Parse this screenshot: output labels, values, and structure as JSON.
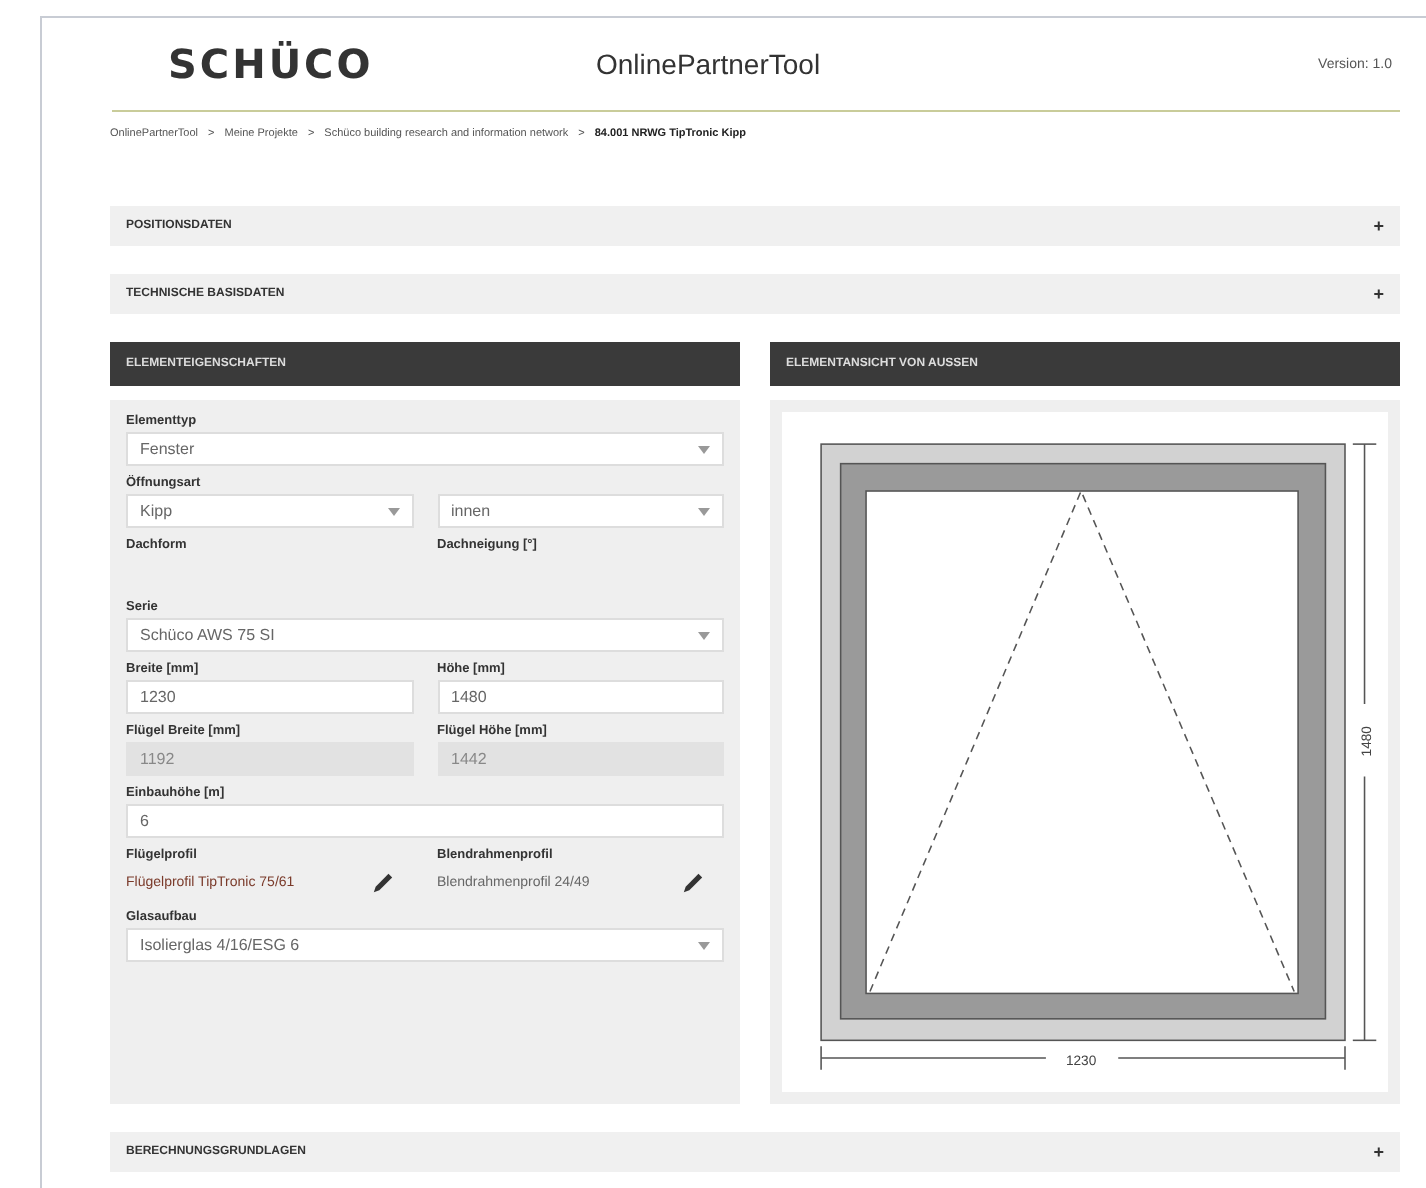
{
  "header": {
    "logo": "SCHÜCO",
    "title": "OnlinePartnerTool",
    "version": "Version: 1.0"
  },
  "breadcrumb": [
    {
      "label": "OnlinePartnerTool",
      "current": false
    },
    {
      "label": "Meine Projekte",
      "current": false
    },
    {
      "label": "Schüco building research and information network",
      "current": false
    },
    {
      "label": "84.001 NRWG TipTronic Kipp",
      "current": true
    }
  ],
  "breadcrumb_separator": ">",
  "top_sections": [
    {
      "title": "POSITIONSDATEN",
      "toggle": "+"
    },
    {
      "title": "TECHNISCHE BASISDATEN",
      "toggle": "+"
    }
  ],
  "properties": {
    "title": "ELEMENTEIGENSCHAFTEN",
    "rows": [
      {
        "fields": [
          {
            "label": "Elementtyp",
            "kind": "select",
            "value": "Fenster"
          }
        ]
      },
      {
        "fields": [
          {
            "label": "Öffnungsart",
            "kind": "select",
            "value": "Kipp"
          },
          {
            "kind": "select",
            "value": "innen"
          }
        ]
      },
      {
        "fields": [
          {
            "label": "Dachform",
            "kind": "empty"
          },
          {
            "label": "Dachneigung [°]",
            "kind": "empty"
          }
        ]
      },
      {
        "fields": [
          {
            "label": "Serie",
            "kind": "select",
            "value": "Schüco AWS 75 SI"
          }
        ]
      },
      {
        "fields": [
          {
            "label": "Breite [mm]",
            "kind": "input",
            "value": "1230"
          },
          {
            "label": "Höhe [mm]",
            "kind": "input",
            "value": "1480"
          }
        ]
      },
      {
        "fields": [
          {
            "label": "Flügel Breite [mm]",
            "kind": "readonly",
            "value": "1192"
          },
          {
            "label": "Flügel Höhe [mm]",
            "kind": "readonly",
            "value": "1442"
          }
        ]
      },
      {
        "fields": [
          {
            "label": "Einbauhöhe [m]",
            "kind": "input",
            "value": "6"
          }
        ]
      },
      {
        "fields": [
          {
            "label": "Flügelprofil",
            "kind": "profile",
            "value": "Flügelprofil TipTronic 75/61",
            "highlighted": true
          },
          {
            "label": "Blendrahmenprofil",
            "kind": "profile",
            "value": "Blendrahmenprofil 24/49",
            "highlighted": false
          }
        ]
      },
      {
        "fields": [
          {
            "label": "Glasaufbau",
            "kind": "select",
            "value": "Isolierglas 4/16/ESG 6"
          }
        ]
      }
    ]
  },
  "view": {
    "title": "ELEMENTANSICHT VON AUSSEN",
    "width_label": "1230",
    "height_label": "1480"
  },
  "bottom_sections": [
    {
      "title": "BERECHNUNGSGRUNDLAGEN",
      "toggle": "+"
    }
  ]
}
